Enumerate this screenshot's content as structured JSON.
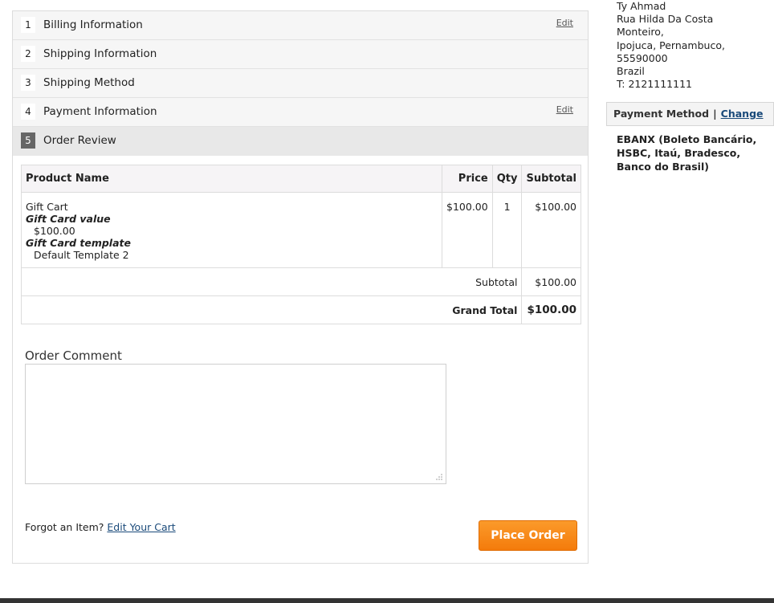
{
  "steps": [
    {
      "number": "1",
      "title": "Billing Information",
      "edit": "Edit"
    },
    {
      "number": "2",
      "title": "Shipping Information"
    },
    {
      "number": "3",
      "title": "Shipping Method"
    },
    {
      "number": "4",
      "title": "Payment Information",
      "edit": "Edit"
    },
    {
      "number": "5",
      "title": "Order Review"
    }
  ],
  "review": {
    "headers": {
      "product": "Product Name",
      "price": "Price",
      "qty": "Qty",
      "subtotal": "Subtotal"
    },
    "item": {
      "name": "Gift Cart",
      "options": [
        {
          "label": "Gift Card value",
          "value": "$100.00"
        },
        {
          "label": "Gift Card template",
          "value": "Default Template 2"
        }
      ],
      "price": "$100.00",
      "qty": "1",
      "subtotal": "$100.00"
    },
    "totals": {
      "subtotal_label": "Subtotal",
      "subtotal_value": "$100.00",
      "grand_label": "Grand Total",
      "grand_value": "$100.00"
    }
  },
  "comment": {
    "label": "Order Comment",
    "value": ""
  },
  "footer": {
    "forgot": "Forgot an Item?",
    "edit_cart": "Edit Your Cart",
    "place_order": "Place Order"
  },
  "sidebar": {
    "address_lines": [
      "Ty Ahmad",
      "Rua Hilda Da Costa",
      "Monteiro,",
      "Ipojuca, Pernambuco,",
      "55590000",
      "Brazil",
      "T: 2121111111"
    ],
    "payment_method_title": "Payment Method",
    "separator": "|",
    "change": "Change",
    "payment_method_lines": [
      "EBANX (Boleto Bancário,",
      "HSBC, Itaú, Bradesco,",
      "Banco do Brasil)"
    ]
  },
  "colors": {
    "accent_button": "#f47b0b",
    "link": "#1a4a7a",
    "active_step": "#666666"
  }
}
